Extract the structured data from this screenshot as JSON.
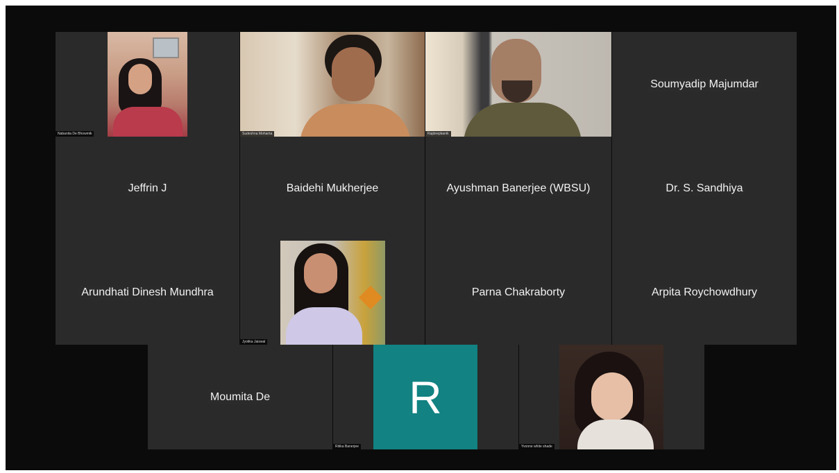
{
  "meeting": {
    "participants": [
      {
        "id": "p1",
        "name": "Nabanita De Bhowmik",
        "video": true,
        "tag": "Nabanita De Bhowmik"
      },
      {
        "id": "p2",
        "name": "Sudeshna Mohanta",
        "video": true,
        "tag": "Sudeshna Mohanta"
      },
      {
        "id": "p3",
        "name": "Rajdeep",
        "video": true,
        "tag": "Rajdeepbanik"
      },
      {
        "id": "p4",
        "name": "Soumyadip Majumdar",
        "video": false
      },
      {
        "id": "p5",
        "name": "Jeffrin J",
        "video": false
      },
      {
        "id": "p6",
        "name": "Baidehi Mukherjee",
        "video": false
      },
      {
        "id": "p7",
        "name": "Ayushman Banerjee (WBSU)",
        "video": false
      },
      {
        "id": "p8",
        "name": "Dr. S. Sandhiya",
        "video": false
      },
      {
        "id": "p9",
        "name": "Arundhati Dinesh Mundhra",
        "video": false
      },
      {
        "id": "p10",
        "name": "Jyotika Jaiswal",
        "video": true,
        "tag": "Jyotika Jaiswal"
      },
      {
        "id": "p11",
        "name": "Parna Chakraborty",
        "video": false
      },
      {
        "id": "p12",
        "name": "Arpita Roychowdhury",
        "video": false
      },
      {
        "id": "p13",
        "name": "Moumita De",
        "video": false
      },
      {
        "id": "p14",
        "name": "Ritika Banerjee",
        "avatar_letter": "R",
        "avatar_color": "#128282",
        "tag": "Ritika Banerjee"
      },
      {
        "id": "p15",
        "name": "Yvonne white shade",
        "video": true,
        "tag": "Yvonne white shade"
      }
    ]
  },
  "colors": {
    "background": "#0b0b0b",
    "tile": "#2a2a2a",
    "avatar": "#128282"
  }
}
